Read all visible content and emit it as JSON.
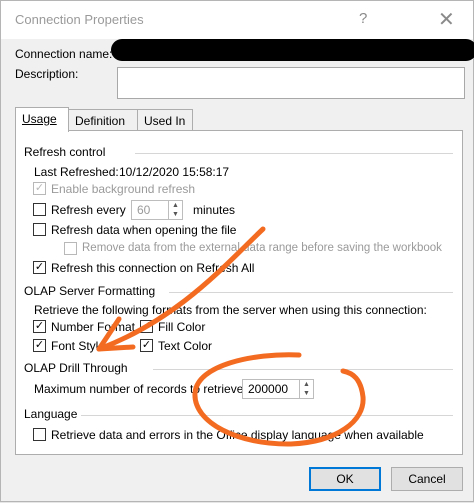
{
  "window": {
    "title": "Connection Properties",
    "help_glyph": "?",
    "close_glyph": "✕"
  },
  "connection": {
    "name_label": "Connection name:",
    "description_label": "Description:"
  },
  "tabs": [
    {
      "label": "Usage"
    },
    {
      "label": "Definition"
    },
    {
      "label": "Used In"
    }
  ],
  "refresh": {
    "section": "Refresh control",
    "last_refreshed_label": "Last Refreshed:",
    "last_refreshed_value": "10/12/2020  15:58:17",
    "enable_background": "Enable background refresh",
    "refresh_every": "Refresh every",
    "refresh_minutes_value": "60",
    "minutes": "minutes",
    "refresh_on_open": "Refresh data when opening the file",
    "remove_data": "Remove data from the external data range before saving the workbook",
    "refresh_all": "Refresh this connection on Refresh All"
  },
  "olap_format": {
    "section": "OLAP Server Formatting",
    "description": "Retrieve the following formats from the server when using this connection:",
    "number_format": "Number Format",
    "fill_color": "Fill Color",
    "font_style": "Font Style",
    "text_color": "Text Color"
  },
  "drill": {
    "section": "OLAP Drill Through",
    "max_records_label": "Maximum number of records to retrieve:",
    "max_records_value": "200000"
  },
  "language": {
    "section": "Language",
    "retrieve_office_language": "Retrieve data and errors in the Office display language when available"
  },
  "buttons": {
    "ok": "OK",
    "cancel": "Cancel"
  },
  "glyphs": {
    "check": "✓",
    "spin_up": "▲",
    "spin_down": "▼"
  },
  "colors": {
    "annotation": "#f36b21",
    "accent": "#0078d7"
  }
}
